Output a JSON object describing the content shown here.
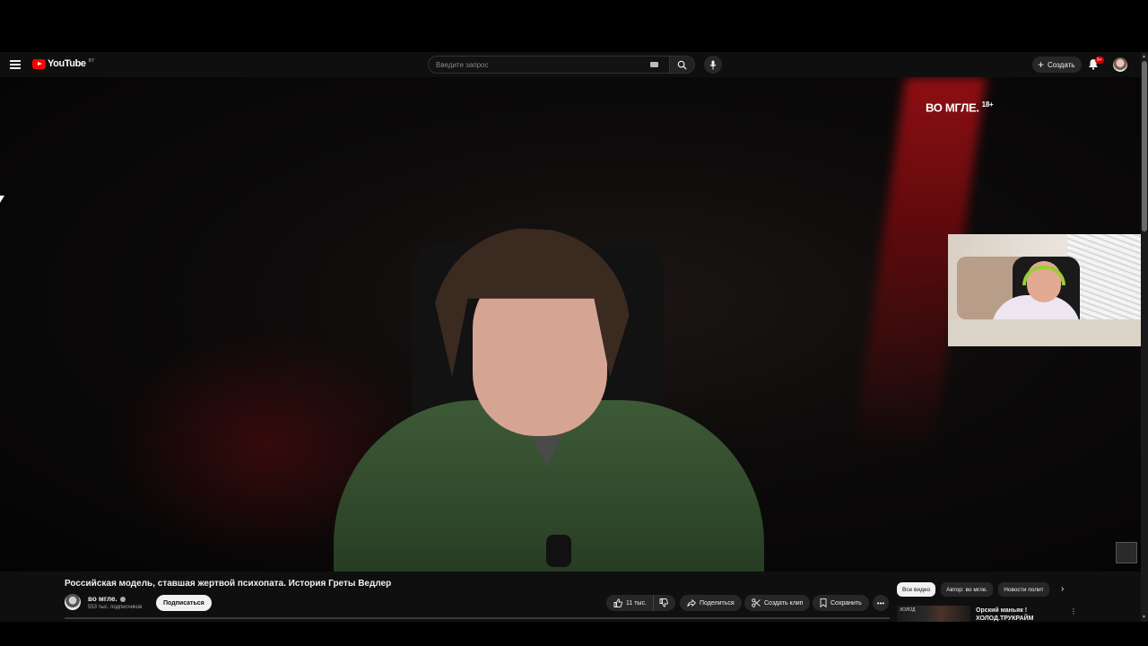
{
  "header": {
    "logo_text": "YouTube",
    "logo_country": "BY",
    "search_placeholder": "Введите запрос",
    "create_label": "Создать",
    "notifications_badge": "9+"
  },
  "video": {
    "watermark": "ВО МГЛЕ.",
    "age_rating": "18+"
  },
  "info": {
    "title": "Российская модель, ставшая жертвой психопата. История Греты Ведлер",
    "channel_name": "во мгле.",
    "subscribers": "553 тыс. подписчиков",
    "subscribe_label": "Подписаться",
    "likes": "11 тыс.",
    "share_label": "Поделиться",
    "clip_label": "Создать клип",
    "save_label": "Сохранить"
  },
  "chips": [
    "Все видео",
    "Автор: во мгле.",
    "Новости полит"
  ],
  "recommendation": {
    "thumb_text": "ХОЛОД",
    "title_line1": "Орский маньяк !",
    "title_line2": "ХОЛОД.ТРУКРАЙМ"
  },
  "colors": {
    "background": "#0f0f0f",
    "brand_red": "#ff0000",
    "pill": "#272727",
    "text": "#f1f1f1",
    "subtext": "#aaaaaa"
  }
}
